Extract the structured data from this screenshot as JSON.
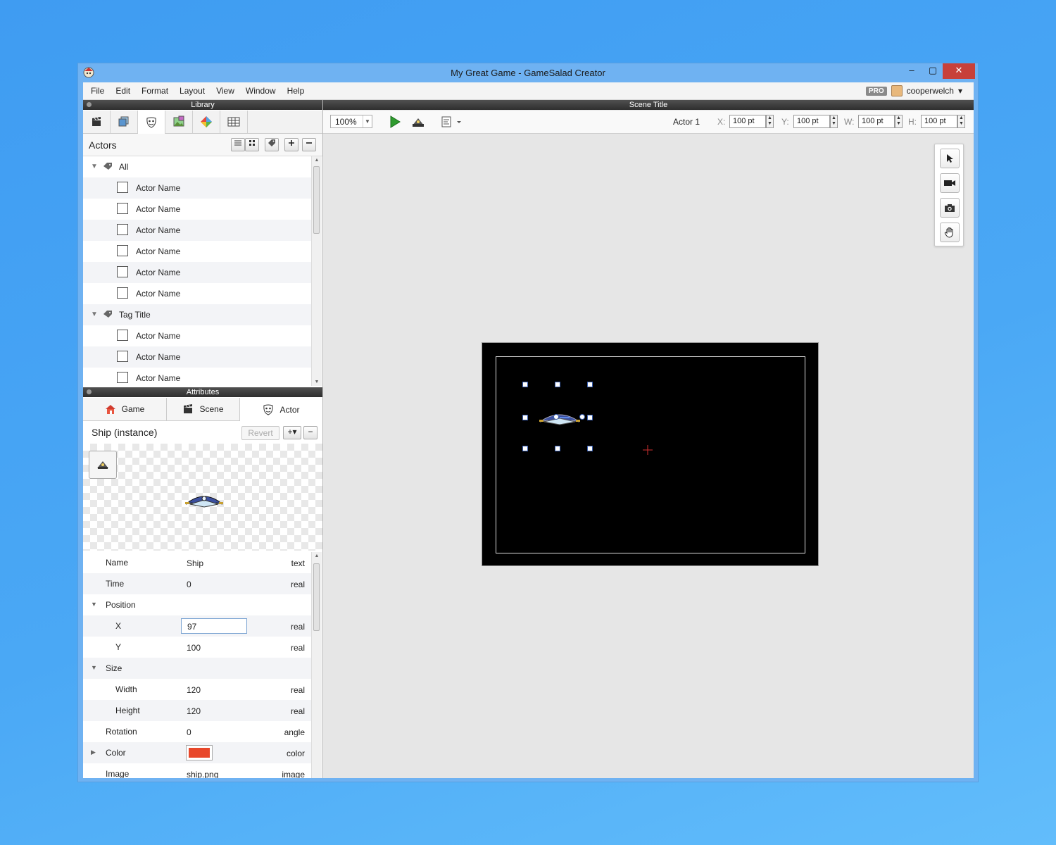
{
  "window": {
    "title": "My Great Game - GameSalad Creator",
    "minimize": "–",
    "maximize": "▢",
    "close": "✕"
  },
  "menu": {
    "items": [
      "File",
      "Edit",
      "Format",
      "Layout",
      "View",
      "Window",
      "Help"
    ]
  },
  "user": {
    "badge": "PRO",
    "name": "cooperwelch",
    "caret": "▾"
  },
  "library": {
    "title": "Library",
    "section_label": "Actors",
    "groups": [
      {
        "label": "All",
        "items": [
          "Actor Name",
          "Actor Name",
          "Actor Name",
          "Actor Name",
          "Actor Name",
          "Actor Name"
        ]
      },
      {
        "label": "Tag Title",
        "items": [
          "Actor Name",
          "Actor Name",
          "Actor Name"
        ]
      }
    ]
  },
  "attributes": {
    "title": "Attributes",
    "tabs": [
      "Game",
      "Scene",
      "Actor"
    ],
    "active_tab": "Actor",
    "instance_label": "Ship (instance)",
    "revert_label": "Revert",
    "add_label": "+▾",
    "remove_label": "−",
    "rows": {
      "name": {
        "key": "Name",
        "value": "Ship",
        "type": "text"
      },
      "time": {
        "key": "Time",
        "value": "0",
        "type": "real"
      },
      "position": {
        "key": "Position"
      },
      "x": {
        "key": "X",
        "value": "97",
        "type": "real"
      },
      "y": {
        "key": "Y",
        "value": "100",
        "type": "real"
      },
      "size": {
        "key": "Size"
      },
      "width": {
        "key": "Width",
        "value": "120",
        "type": "real"
      },
      "height": {
        "key": "Height",
        "value": "120",
        "type": "real"
      },
      "rotation": {
        "key": "Rotation",
        "value": "0",
        "type": "angle"
      },
      "color": {
        "key": "Color",
        "type": "color",
        "swatch": "#e8472a"
      },
      "image": {
        "key": "Image",
        "value": "ship.png",
        "type": "image"
      }
    }
  },
  "scene": {
    "title": "Scene Title",
    "zoom": "100%",
    "actor_label": "Actor 1",
    "fields": [
      {
        "label": "X:",
        "value": "100 pt"
      },
      {
        "label": "Y:",
        "value": "100 pt"
      },
      {
        "label": "W:",
        "value": "100 pt"
      },
      {
        "label": "H:",
        "value": "100 pt"
      }
    ]
  },
  "colors": {
    "accent": "#3a5fb0",
    "play": "#2e9b2e",
    "stage": "#000000"
  }
}
